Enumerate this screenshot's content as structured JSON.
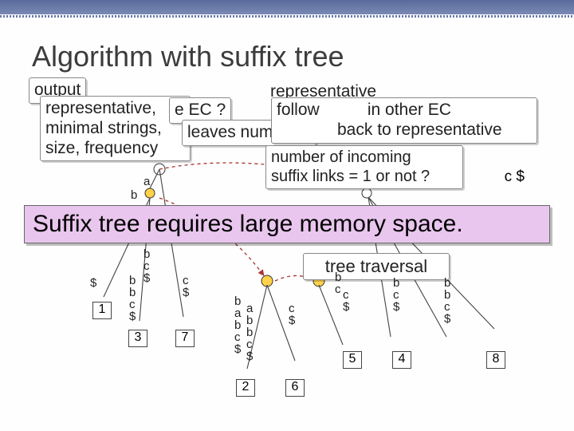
{
  "title": "Algorithm with suffix tree",
  "boxes": {
    "output_hdr": "output",
    "output_body1": "representative,",
    "output_body2": "minimal strings,",
    "output_body3": "size, frequency",
    "q_ec_tail": "e EC ?",
    "q_leaves": "leaves number ?",
    "rep_hdr": "representative",
    "rep_body1a": "follow",
    "rep_body1b": "in other EC",
    "rep_body2": "back to representative",
    "q_incoming1": "number of incoming",
    "q_incoming2": "suffix links = 1 or not ?",
    "traversal": "tree traversal"
  },
  "banner": "Suffix tree requires large memory space.",
  "leaves": {
    "l1": "1",
    "l2": "2",
    "l3": "3",
    "l4": "4",
    "l5": "5",
    "l6": "6",
    "l7": "7",
    "l8": "8"
  },
  "labels": {
    "a": "a",
    "b": "b",
    "c": "c",
    "d": "$",
    "e1": "$",
    "bc": "b\nc\n$",
    "bbc": "b\nb\nc\n$",
    "cd": "c\n$",
    "bab": "b\na\nb\nc\n$",
    "abbc": "a\nb\nb\nc\n$",
    "cb": "b\nc",
    "bcd": "b\nc\n$",
    "cs": "c\n$",
    "cbar": "c $"
  }
}
